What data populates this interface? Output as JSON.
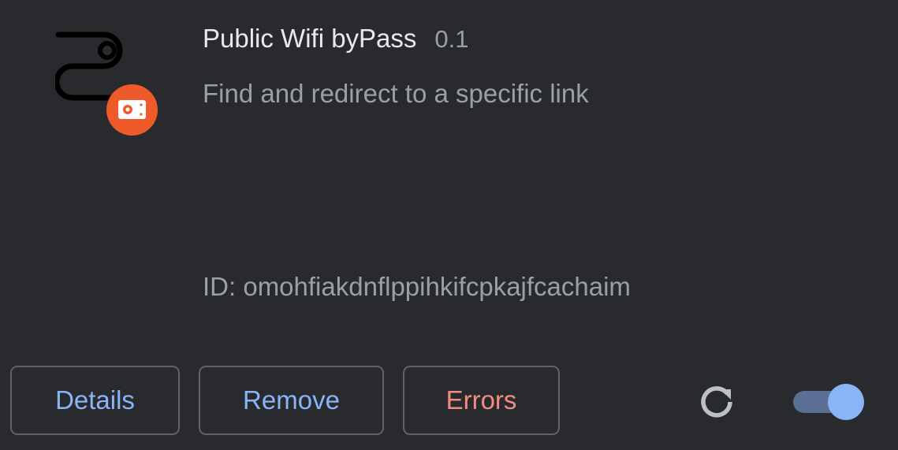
{
  "extension": {
    "name": "Public Wifi byPass",
    "version": "0.1",
    "description": "Find and redirect to a specific link",
    "id_text": "ID: omohfiakdnflppihkifcpkajfcachaim",
    "icon": "cable-plug-icon",
    "badge_icon": "unpacked-badge-icon"
  },
  "actions": {
    "details_label": "Details",
    "remove_label": "Remove",
    "errors_label": "Errors",
    "reload_icon": "reload-icon"
  },
  "toggle": {
    "enabled": true
  },
  "colors": {
    "background": "#292a2d",
    "link_blue": "#8ab4f8",
    "error_red": "#f28b82",
    "badge_orange": "#ef5a2a"
  }
}
